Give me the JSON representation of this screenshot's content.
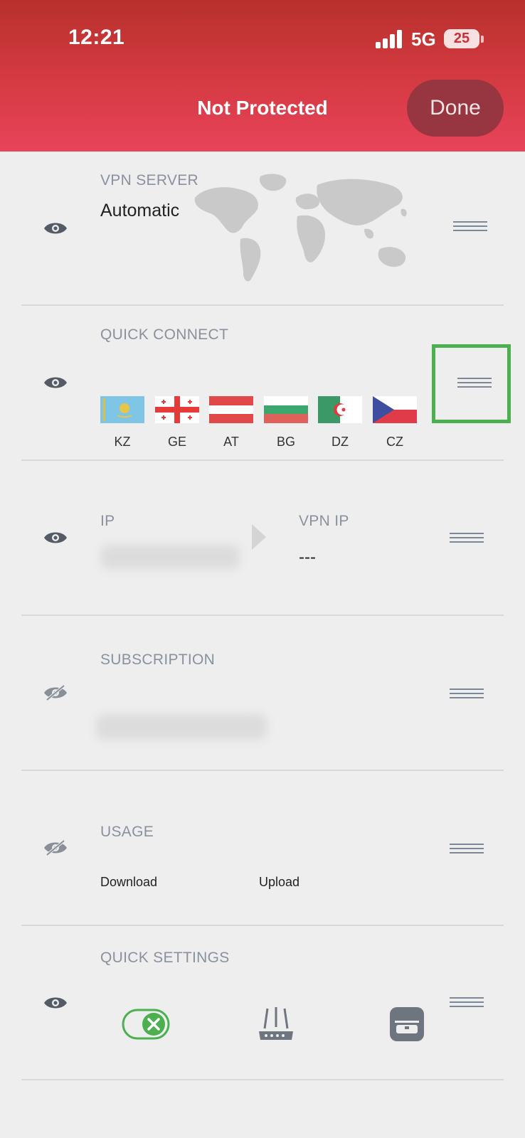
{
  "status_bar": {
    "time": "12:21",
    "network": "5G",
    "battery": "25"
  },
  "header": {
    "title": "Not Protected",
    "done_label": "Done"
  },
  "vpn_server": {
    "label": "VPN SERVER",
    "value": "Automatic"
  },
  "quick_connect": {
    "label": "QUICK CONNECT",
    "countries": [
      {
        "code": "KZ"
      },
      {
        "code": "GE"
      },
      {
        "code": "AT"
      },
      {
        "code": "BG"
      },
      {
        "code": "DZ"
      },
      {
        "code": "CZ"
      }
    ]
  },
  "ip": {
    "label": "IP",
    "vpn_label": "VPN IP",
    "vpn_value": "---"
  },
  "subscription": {
    "label": "SUBSCRIPTION"
  },
  "usage": {
    "label": "USAGE",
    "download_label": "Download",
    "upload_label": "Upload"
  },
  "quick_settings": {
    "label": "QUICK SETTINGS"
  },
  "colors": {
    "header_red": "#d33a40",
    "done_button": "#973540",
    "highlight_green": "#4caf50",
    "toggle_green": "#4caf50"
  },
  "icons": {
    "visible": "eye-icon",
    "hidden": "eye-off-icon",
    "reorder": "reorder-handle-icon",
    "router": "router-icon",
    "incognito": "incognito-icon",
    "kill_switch": "kill-switch-toggle"
  }
}
